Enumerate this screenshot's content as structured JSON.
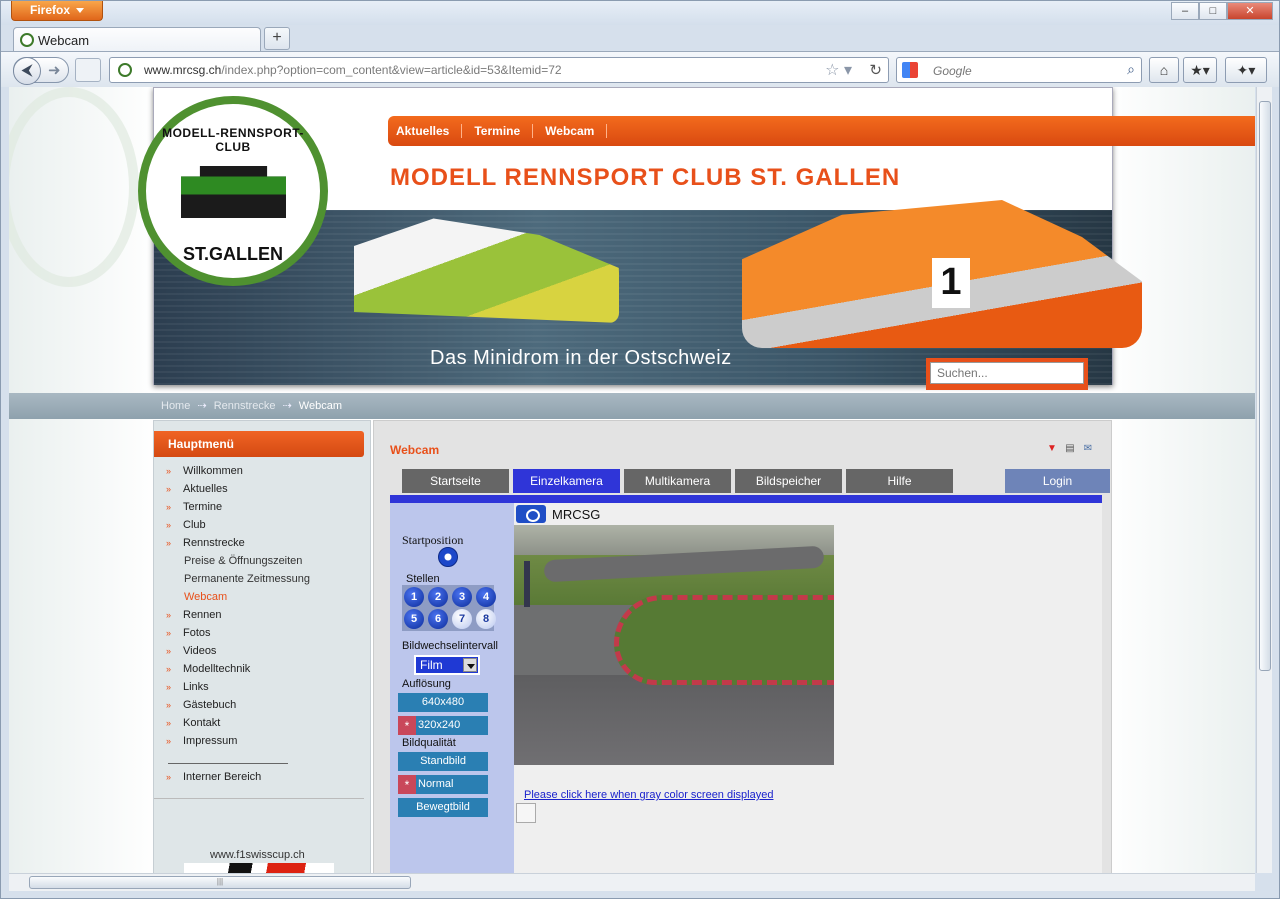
{
  "browser": {
    "menu_button": "Firefox",
    "tab_title": "Webcam",
    "url_host": "www.mrcsg.ch",
    "url_path": "/index.php?option=com_content&view=article&id=53&Itemid=72",
    "search_placeholder": "Google"
  },
  "header": {
    "logo_top": "MODELL-RENNSPORT-CLUB",
    "logo_bottom": "ST.GALLEN",
    "nav": [
      "Aktuelles",
      "Termine",
      "Webcam"
    ],
    "club_title": "MODELL RENNSPORT CLUB ST. GALLEN",
    "subtitle": "Das Minidrom in der Ostschweiz",
    "car_number": "1",
    "search_placeholder": "Suchen..."
  },
  "breadcrumb": {
    "home": "Home",
    "section": "Rennstrecke",
    "current": "Webcam",
    "separator": "⇢"
  },
  "sidebar": {
    "title": "Hauptmenü",
    "items": [
      {
        "label": "Willkommen"
      },
      {
        "label": "Aktuelles"
      },
      {
        "label": "Termine"
      },
      {
        "label": "Club"
      },
      {
        "label": "Rennstrecke"
      },
      {
        "label": "Preise & Öffnungszeiten"
      },
      {
        "label": "Permanente Zeitmessung"
      },
      {
        "label": "Webcam"
      },
      {
        "label": "Rennen"
      },
      {
        "label": "Fotos"
      },
      {
        "label": "Videos"
      },
      {
        "label": "Modelltechnik"
      },
      {
        "label": "Links"
      },
      {
        "label": "Gästebuch"
      },
      {
        "label": "Kontakt"
      },
      {
        "label": "Impressum"
      }
    ],
    "internal": "Interner Bereich",
    "sponsor": "www.f1swisscup.ch"
  },
  "main": {
    "title": "Webcam",
    "tabs": [
      "Startseite",
      "Einzelkamera",
      "Multikamera",
      "Bildspeicher",
      "Hilfe"
    ],
    "login": "Login",
    "camera_name": "MRCSG",
    "startposition_label": "Startposition",
    "stellen_label": "Stellen",
    "presets": [
      "1",
      "2",
      "3",
      "4",
      "5",
      "6",
      "7",
      "8"
    ],
    "interval_label": "Bildwechselintervall",
    "interval_value": "Film",
    "resolution_label": "Auflösung",
    "res_options": [
      "640x480",
      "320x240"
    ],
    "quality_label": "Bildqualität",
    "quality_options": [
      "Standbild",
      "Normal",
      "Bewegtbild"
    ],
    "selected_marker": "*",
    "gray_link": "Please click here when gray color screen displayed"
  }
}
